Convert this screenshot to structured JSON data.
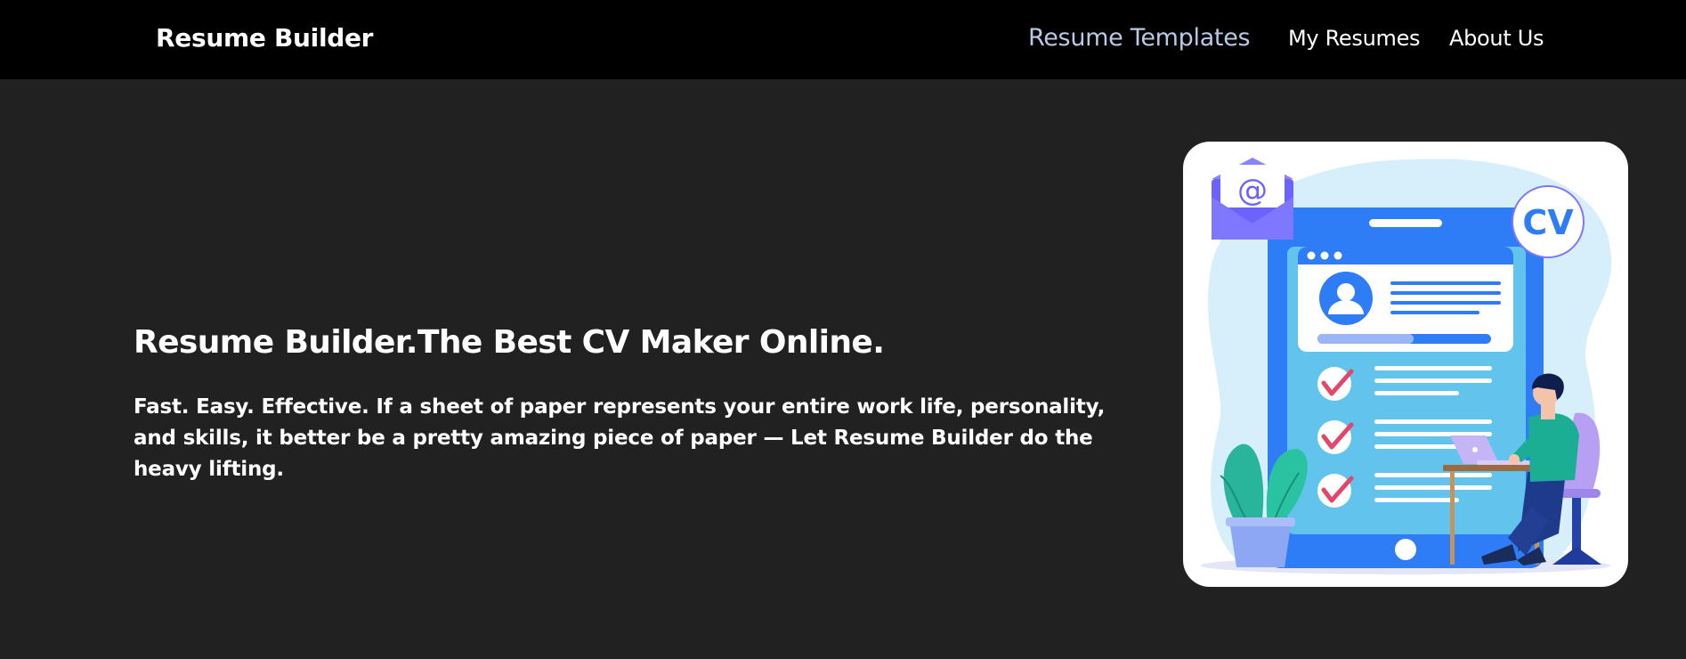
{
  "header": {
    "brand": "Resume Builder",
    "nav": [
      {
        "label": "Resume Templates",
        "active": true
      },
      {
        "label": "My Resumes",
        "active": false
      },
      {
        "label": "About Us",
        "active": false
      }
    ]
  },
  "hero": {
    "title": "Resume Builder.The Best CV Maker Online.",
    "subtitle": "Fast. Easy. Effective. If a sheet of paper represents your entire work life, personality, and skills, it better be a pretty amazing piece of paper — Let Resume Builder do the heavy lifting.",
    "illustration": {
      "badge_text": "CV",
      "email_symbol": "@"
    }
  },
  "colors": {
    "background": "#212121",
    "header": "#000000",
    "active_nav": "#b8c9e6",
    "text": "#ffffff",
    "accent_blue": "#2f7df6"
  }
}
